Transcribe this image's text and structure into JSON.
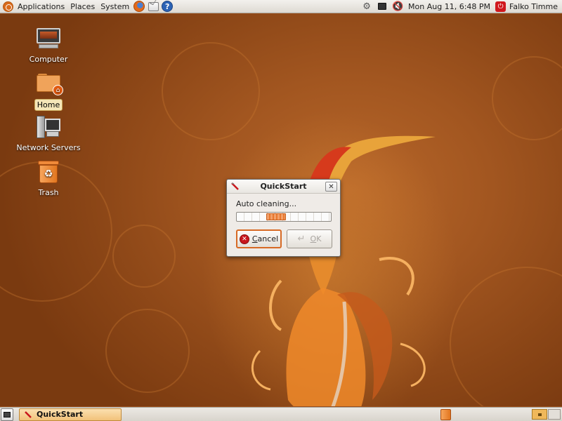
{
  "top_panel": {
    "menus": [
      "Applications",
      "Places",
      "System"
    ],
    "clock": "Mon Aug 11,  6:48 PM",
    "user": "Falko Timme",
    "help_glyph": "?"
  },
  "desktop_icons": [
    {
      "label": "Computer",
      "icon": "computer-icon"
    },
    {
      "label": "Home",
      "icon": "home-folder-icon"
    },
    {
      "label": "Network Servers",
      "icon": "network-servers-icon"
    },
    {
      "label": "Trash",
      "icon": "trash-icon"
    }
  ],
  "dialog": {
    "title": "QuickStart",
    "status": "Auto cleaning...",
    "progress_position": 0.4,
    "cancel_label": "Cancel",
    "ok_label": "OK"
  },
  "bottom_panel": {
    "task_label": "QuickStart"
  },
  "colors": {
    "accent": "#d76a25",
    "desktop": "#9a4f1c"
  }
}
